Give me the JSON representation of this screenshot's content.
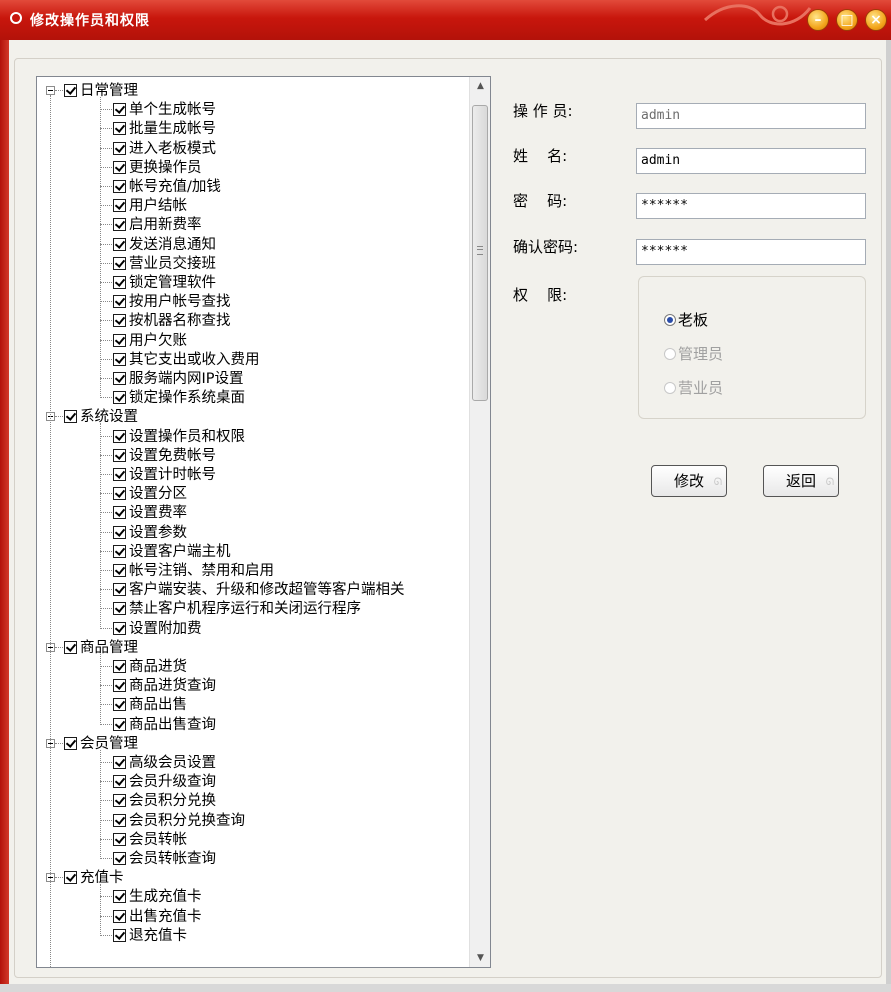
{
  "window": {
    "title": "修改操作员和权限"
  },
  "tree": {
    "groups": [
      {
        "label": "日常管理",
        "items": [
          "单个生成帐号",
          "批量生成帐号",
          "进入老板模式",
          "更换操作员",
          "帐号充值/加钱",
          "用户结帐",
          "启用新费率",
          "发送消息通知",
          "营业员交接班",
          "锁定管理软件",
          "按用户帐号查找",
          "按机器名称查找",
          "用户欠账",
          "其它支出或收入费用",
          "服务端内网IP设置",
          "锁定操作系统桌面"
        ]
      },
      {
        "label": "系统设置",
        "items": [
          "设置操作员和权限",
          "设置免费帐号",
          "设置计时帐号",
          "设置分区",
          "设置费率",
          "设置参数",
          "设置客户端主机",
          "帐号注销、禁用和启用",
          "客户端安装、升级和修改超管等客户端相关",
          "禁止客户机程序运行和关闭运行程序",
          "设置附加费"
        ]
      },
      {
        "label": "商品管理",
        "items": [
          "商品进货",
          "商品进货查询",
          "商品出售",
          "商品出售查询"
        ]
      },
      {
        "label": "会员管理",
        "items": [
          "高级会员设置",
          "会员升级查询",
          "会员积分兑换",
          "会员积分兑换查询",
          "会员转帐",
          "会员转帐查询"
        ]
      },
      {
        "label": "充值卡",
        "items": [
          "生成充值卡",
          "出售充值卡",
          "退充值卡"
        ]
      }
    ]
  },
  "form": {
    "operator_label": "操 作 员:",
    "operator_value": "admin",
    "name_label": "姓    名:",
    "name_value": "admin",
    "password_label": "密    码:",
    "password_value": "******",
    "confirm_label": "确认密码:",
    "confirm_value": "******",
    "permission_label": "权    限:",
    "roles": [
      {
        "label": "老板",
        "checked": true,
        "enabled": true
      },
      {
        "label": "管理员",
        "checked": false,
        "enabled": false
      },
      {
        "label": "营业员",
        "checked": false,
        "enabled": false
      }
    ]
  },
  "buttons": {
    "modify": "修改",
    "back": "返回"
  }
}
